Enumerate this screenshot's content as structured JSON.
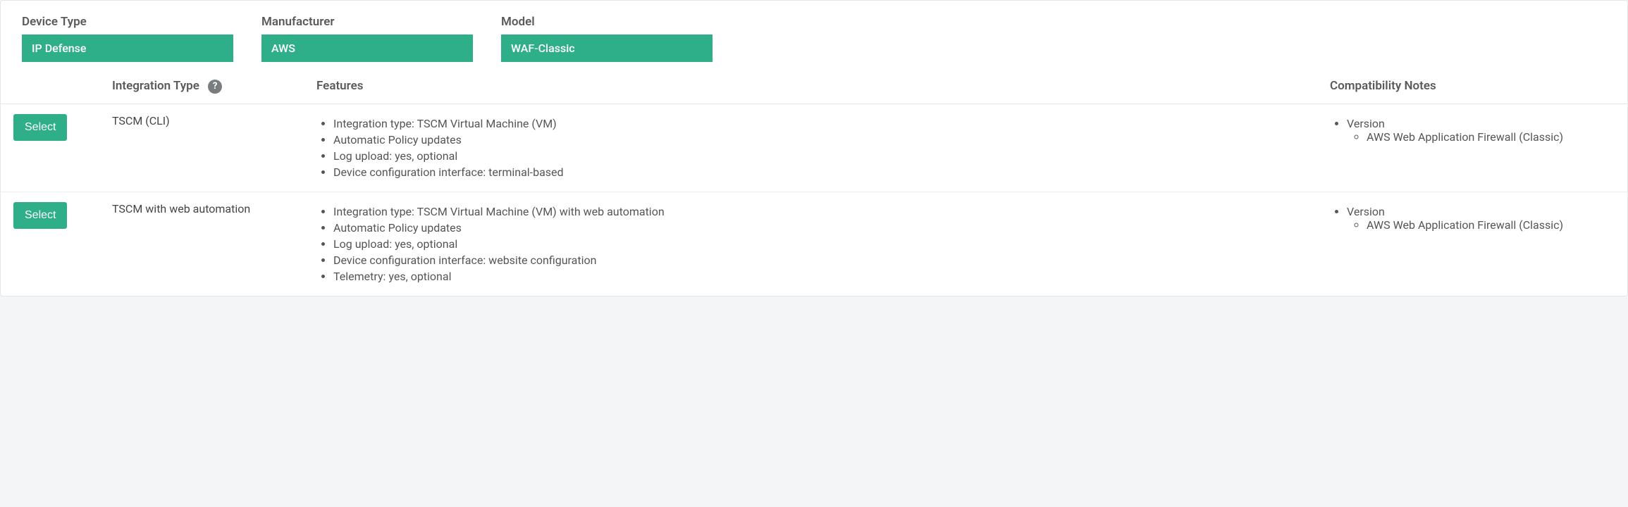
{
  "filters": {
    "device_type": {
      "label": "Device Type",
      "value": "IP Defense"
    },
    "manufacturer": {
      "label": "Manufacturer",
      "value": "AWS"
    },
    "model": {
      "label": "Model",
      "value": "WAF-Classic"
    }
  },
  "columns": {
    "integration_type": "Integration Type",
    "features": "Features",
    "compatibility": "Compatibility Notes",
    "select_btn": "Select"
  },
  "rows": [
    {
      "integration_type": "TSCM (CLI)",
      "features": [
        "Integration type: TSCM Virtual Machine (VM)",
        "Automatic Policy updates",
        "Log upload: yes, optional",
        "Device configuration interface: terminal-based"
      ],
      "compat_heading": "Version",
      "compat_items": [
        "AWS Web Application Firewall (Classic)"
      ]
    },
    {
      "integration_type": "TSCM with web automation",
      "features": [
        "Integration type: TSCM Virtual Machine (VM) with web automation",
        "Automatic Policy updates",
        "Log upload: yes, optional",
        "Device configuration interface: website configuration",
        "Telemetry: yes, optional"
      ],
      "compat_heading": "Version",
      "compat_items": [
        "AWS Web Application Firewall (Classic)"
      ]
    }
  ]
}
